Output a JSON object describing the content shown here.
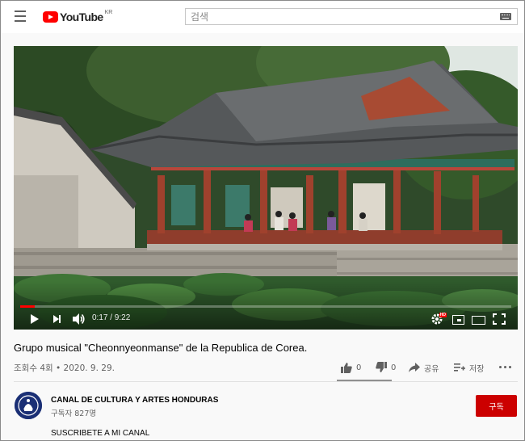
{
  "masthead": {
    "logo_text": "YouTube",
    "region": "KR",
    "search_placeholder": "검색"
  },
  "player": {
    "current_time": "0:17",
    "duration": "9:22",
    "time_display": "0:17 / 9:22",
    "progress_fraction": 0.03,
    "hd_label": "HD"
  },
  "video": {
    "title": "Grupo musical \"Cheonnyeonmanse\" de la Republica de Corea.",
    "views_date": "조회수 4회 • 2020. 9. 29."
  },
  "actions": {
    "like_count": "0",
    "dislike_count": "0",
    "share_label": "공유",
    "save_label": "저장"
  },
  "channel": {
    "name": "CANAL DE CULTURA Y ARTES HONDURAS",
    "subscribers": "구독자 827명",
    "subscribe_label": "구독"
  },
  "description": {
    "first_line": "SUSCRIBETE A MI CANAL"
  },
  "colors": {
    "brand_red": "#ff0000",
    "subscribe_red": "#cc0000",
    "page_bg": "#f9f9f9"
  }
}
